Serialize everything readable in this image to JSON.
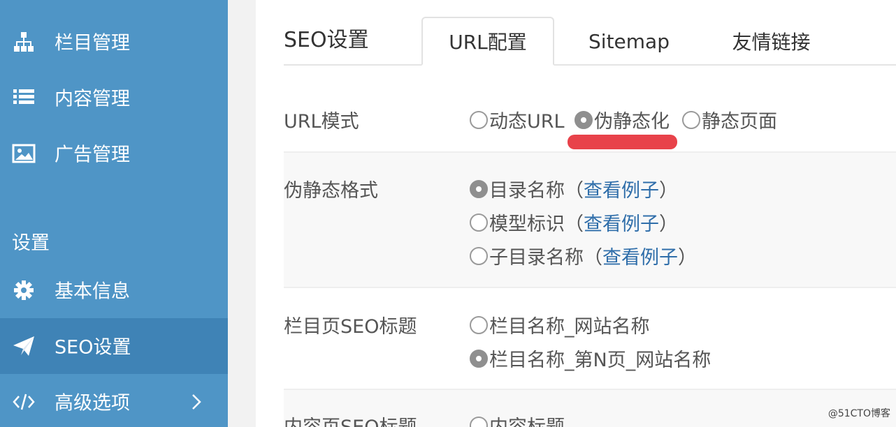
{
  "sidebar": {
    "items": [
      {
        "label": "栏目管理",
        "icon": "sitemap-icon"
      },
      {
        "label": "内容管理",
        "icon": "list-icon"
      },
      {
        "label": "广告管理",
        "icon": "image-icon"
      }
    ],
    "section_label": "设置",
    "settings_items": [
      {
        "label": "基本信息",
        "icon": "gear-icon"
      },
      {
        "label": "SEO设置",
        "icon": "paper-plane-icon",
        "active": true
      },
      {
        "label": "高级选项",
        "icon": "code-icon"
      }
    ],
    "colors": {
      "background": "#4f95c6",
      "active": "#3f83b6"
    }
  },
  "main": {
    "page_title": "SEO设置",
    "tabs": [
      {
        "label": "URL配置",
        "active": true
      },
      {
        "label": "Sitemap"
      },
      {
        "label": "友情链接"
      }
    ],
    "url_mode": {
      "label": "URL模式",
      "options": [
        {
          "label": "动态URL",
          "checked": false
        },
        {
          "label": "伪静态化",
          "checked": true
        },
        {
          "label": "静态页面",
          "checked": false
        }
      ]
    },
    "rewrite_format": {
      "label": "伪静态格式",
      "options": [
        {
          "label": "目录名称（",
          "link": "查看例子",
          "suffix": "）",
          "checked": true
        },
        {
          "label": "模型标识（",
          "link": "查看例子",
          "suffix": "）",
          "checked": false
        },
        {
          "label": "子目录名称（",
          "link": "查看例子",
          "suffix": "）",
          "checked": false
        }
      ]
    },
    "category_seo_title": {
      "label": "栏目页SEO标题",
      "options": [
        {
          "label": "栏目名称_网站名称",
          "checked": false
        },
        {
          "label": "栏目名称_第N页_网站名称",
          "checked": true
        }
      ]
    },
    "content_seo_title": {
      "label": "内容页SEO标题",
      "options": [
        {
          "label": "内容标题",
          "checked": false
        }
      ]
    },
    "accent_mark_color": "#e8424a",
    "link_color": "#2f6eaa"
  },
  "watermark": "@51CTO博客"
}
